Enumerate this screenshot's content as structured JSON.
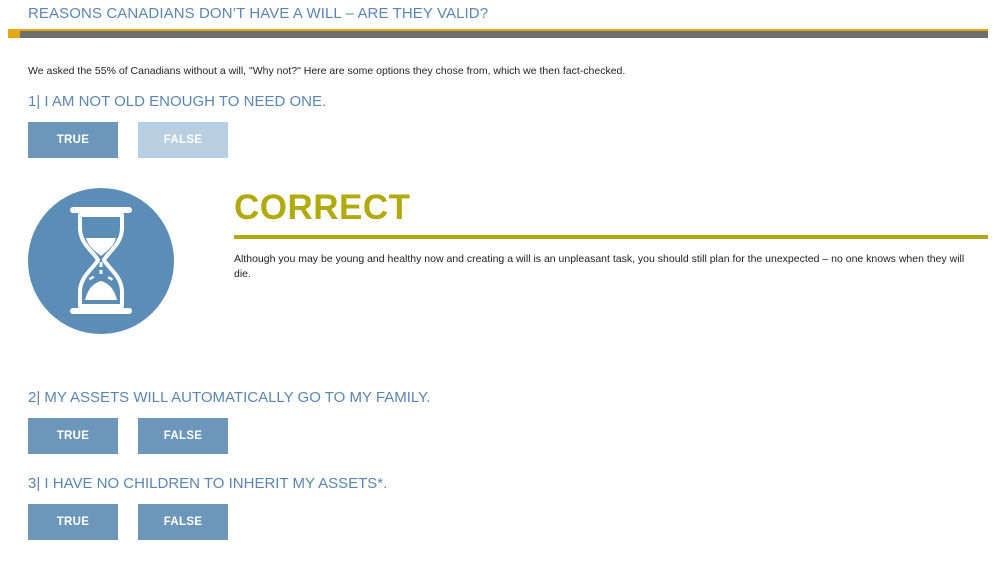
{
  "page": {
    "title": "REASONS CANADIANS DON’T HAVE A WILL – ARE THEY VALID?",
    "intro": "We asked the 55% of Canadians without a will, \"Why not?\" Here are some options they chose from, which we then fact-checked."
  },
  "colors": {
    "heading_blue": "#5b86b3",
    "button_blue": "#6d96bb",
    "button_dim": "#b8cfe1",
    "accent_gold": "#e4a912",
    "correct_olive": "#b1aa0a",
    "rule_gray": "#6f6f70"
  },
  "questions": [
    {
      "text": "1| I AM NOT OLD ENOUGH TO NEED ONE.",
      "true_label": "TRUE",
      "false_label": "FALSE",
      "selected": "TRUE",
      "result": {
        "icon": "hourglass-icon",
        "heading": "CORRECT",
        "text": "Although you may be young and healthy now and creating a will is an unpleasant task, you should still plan for the unexpected – no one knows when they will die."
      }
    },
    {
      "text": "2| MY ASSETS WILL AUTOMATICALLY GO TO MY FAMILY.",
      "true_label": "TRUE",
      "false_label": "FALSE"
    },
    {
      "text": "3| I HAVE NO CHILDREN TO INHERIT MY ASSETS*.",
      "true_label": "TRUE",
      "false_label": "FALSE"
    }
  ]
}
